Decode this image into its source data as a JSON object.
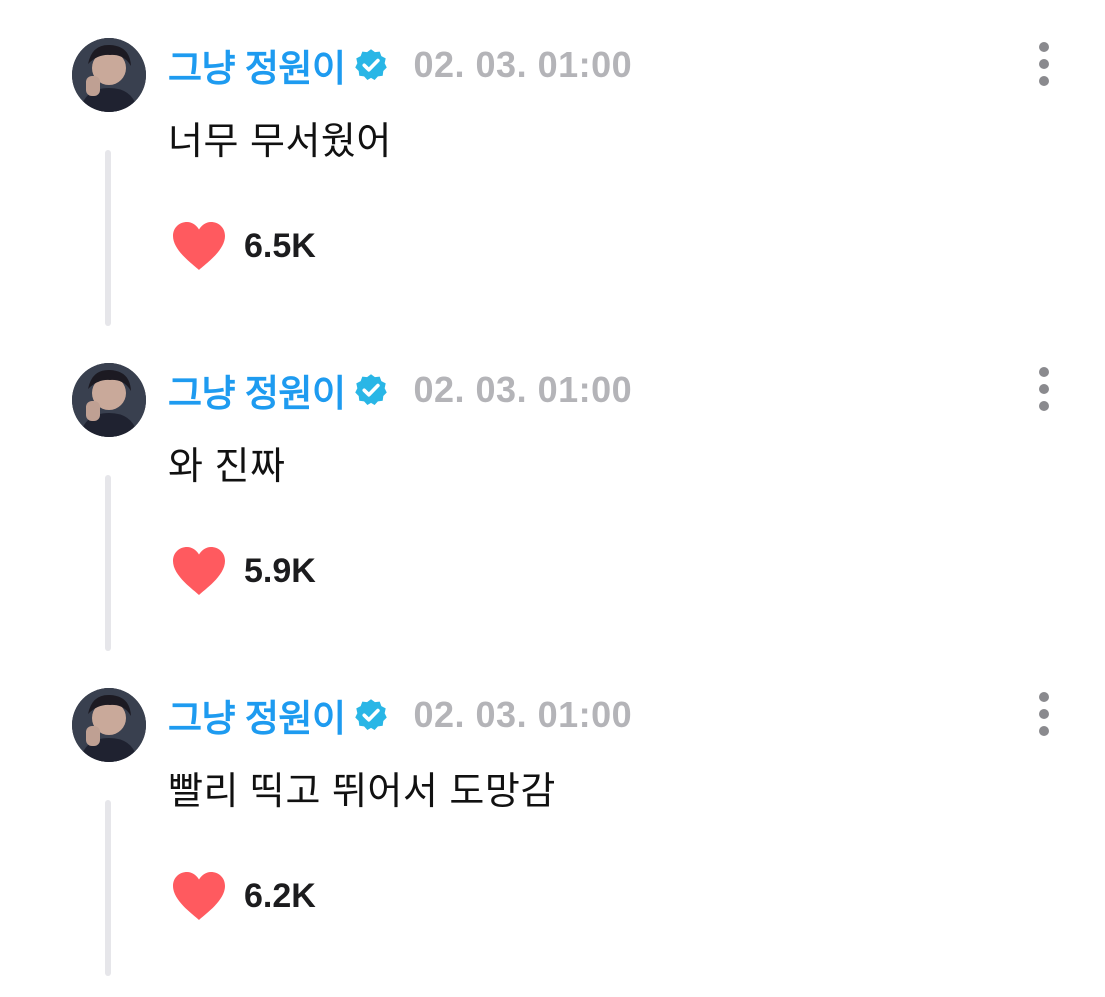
{
  "colors": {
    "username": "#1e9bf0",
    "verified_badge": "#29b6e6",
    "timestamp": "#b4b4b8",
    "heart": "#ff5a5f",
    "text": "#111111",
    "thread_line": "#e6e6ea"
  },
  "icons": {
    "verified": "verified-badge-icon",
    "heart": "heart-icon",
    "more": "more-vertical-icon"
  },
  "posts": [
    {
      "username": "그냥 정원이",
      "timestamp": "02. 03. 01:00",
      "text": "너무 무서웠어",
      "likes": "6.5K"
    },
    {
      "username": "그냥 정원이",
      "timestamp": "02. 03. 01:00",
      "text": "와 진짜",
      "likes": "5.9K"
    },
    {
      "username": "그냥 정원이",
      "timestamp": "02. 03. 01:00",
      "text": "빨리 띡고 뛰어서 도망감",
      "likes": "6.2K"
    }
  ]
}
